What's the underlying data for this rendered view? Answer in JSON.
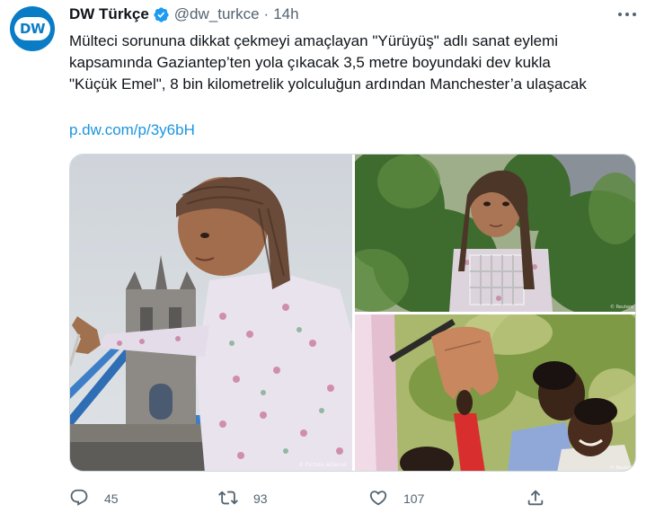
{
  "tweet": {
    "avatar_text": "DW",
    "author_name": "DW Türkçe",
    "handle": "@dw_turkce",
    "separator": "·",
    "time": "14h",
    "text_lines": [
      "Mülteci sorununa dikkat çekmeyi amaçlayan \"Yürüyüş\" adlı sanat eylemi",
      "kapsamında Gaziantep’ten yola çıkacak 3,5 metre boyundaki dev kukla",
      "\"Küçük Emel\", 8 bin kilometrelik yolculuğun ardından Manchester’a ulaşacak"
    ],
    "link": "p.dw.com/p/3y6bH"
  },
  "actions": {
    "replies": "45",
    "retweets": "93",
    "likes": "107"
  },
  "icons": {
    "verified": "verified-badge-icon",
    "more": "more-icon",
    "reply": "reply-icon",
    "retweet": "retweet-icon",
    "like": "heart-icon",
    "share": "share-icon"
  },
  "colors": {
    "brand": "#0a7cc6",
    "link": "#1b95e0",
    "secondary_text": "#536471",
    "verified": "#1d9bf0"
  }
}
